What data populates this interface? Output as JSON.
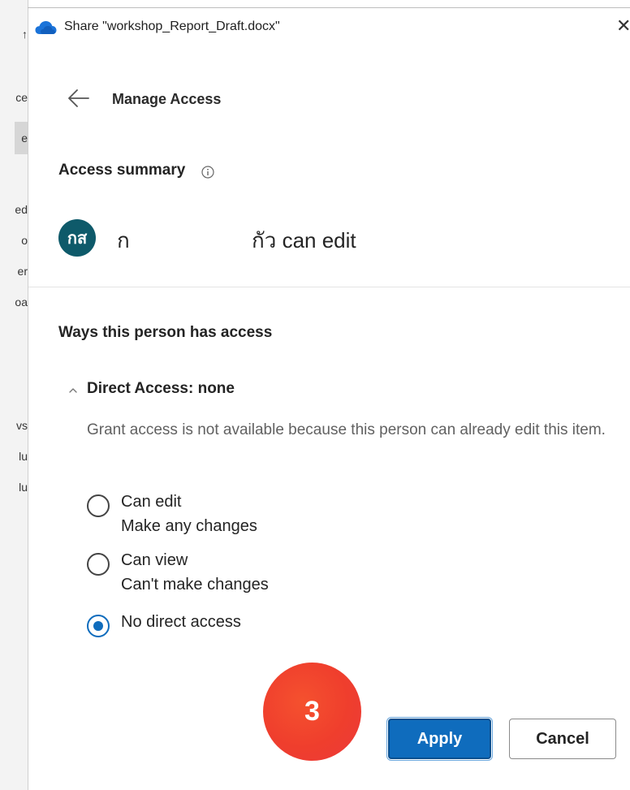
{
  "window": {
    "title": "Share \"workshop_Report_Draft.docx\"",
    "close_glyph": "✕",
    "app_icon": "onedrive-cloud-icon",
    "accent_color": "#0f6cbd"
  },
  "background_fragments": [
    "↑",
    "ce",
    "e",
    "ed",
    "o",
    "er",
    "oa",
    "vs",
    "lu",
    "lu"
  ],
  "header": {
    "back_icon": "arrow-left-icon",
    "title": "Manage Access"
  },
  "summary": {
    "label": "Access summary",
    "info_icon": "info-icon",
    "avatar_initials": "กส",
    "avatar_color": "#0e5a6a",
    "person_first": "ก",
    "person_last_access": "กัว can edit"
  },
  "ways": {
    "label": "Ways this person has access",
    "section_title": "Direct Access: none",
    "note": "Grant access is not available because this person can already edit this item.",
    "options": [
      {
        "label": "Can edit",
        "description": "Make any changes",
        "selected": false
      },
      {
        "label": "Can view",
        "description": "Can't make changes",
        "selected": false
      },
      {
        "label": "No direct access",
        "description": "",
        "selected": true
      }
    ]
  },
  "step_badge": {
    "number": "3",
    "color": "#ef3e2d"
  },
  "footer": {
    "apply_label": "Apply",
    "cancel_label": "Cancel"
  }
}
